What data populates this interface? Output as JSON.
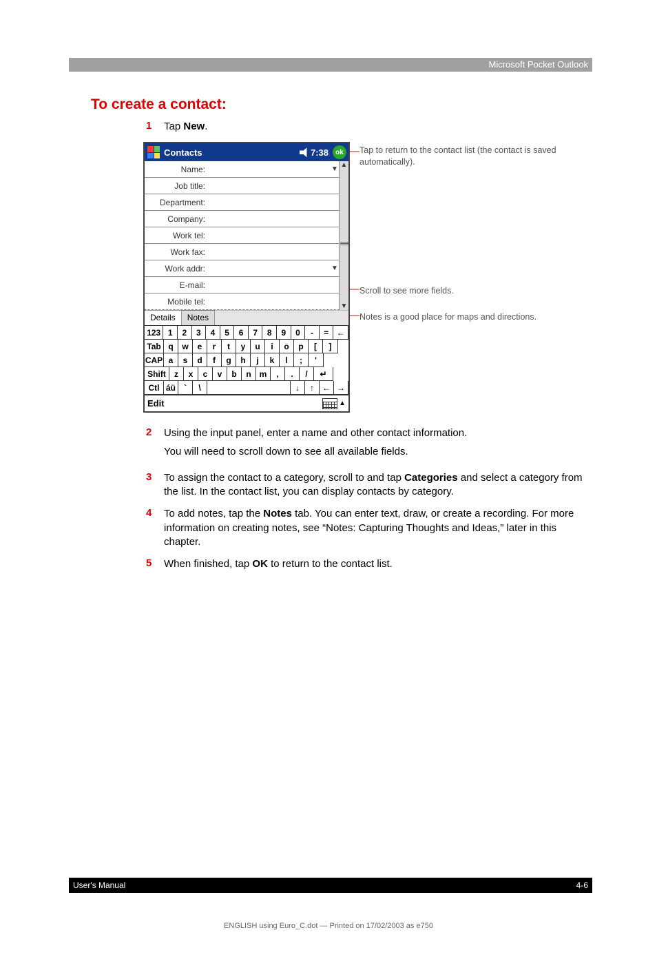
{
  "header": {
    "section": "Microsoft Pocket Outlook"
  },
  "title": "To create a contact:",
  "steps": {
    "s1": {
      "num": "1",
      "text_pre": "Tap ",
      "bold": "New",
      "text_post": "."
    },
    "s2": {
      "num": "2",
      "line1": "Using the input panel, enter a name and other contact information.",
      "line2": "You will need to scroll down to see all available fields."
    },
    "s3": {
      "num": "3",
      "pre": "To assign the contact to a category, scroll to and tap ",
      "bold": "Categories",
      "post": " and select a category from the list. In the contact list, you can display contacts by category."
    },
    "s4": {
      "num": "4",
      "pre": "To add notes, tap the ",
      "bold": "Notes",
      "post": " tab. You can enter text, draw, or create a recording. For more information on creating notes, see “Notes: Capturing Thoughts and Ideas,” later in this chapter."
    },
    "s5": {
      "num": "5",
      "pre": "When finished, tap ",
      "bold": "OK",
      "post": " to return to the contact list."
    }
  },
  "device": {
    "title": "Contacts",
    "time": "7:38",
    "ok": "ok",
    "fields": {
      "name": "Name:",
      "jobtitle": "Job title:",
      "department": "Department:",
      "company": "Company:",
      "worktel": "Work tel:",
      "workfax": "Work fax:",
      "workaddr": "Work addr:",
      "email": "E-mail:",
      "mobiletel": "Mobile tel:"
    },
    "tabs": {
      "details": "Details",
      "notes": "Notes"
    },
    "keyboard": {
      "r1": [
        "123",
        "1",
        "2",
        "3",
        "4",
        "5",
        "6",
        "7",
        "8",
        "9",
        "0",
        "-",
        "=",
        "←"
      ],
      "r2": [
        "Tab",
        "q",
        "w",
        "e",
        "r",
        "t",
        "y",
        "u",
        "i",
        "o",
        "p",
        "[",
        "]"
      ],
      "r3": [
        "CAP",
        "a",
        "s",
        "d",
        "f",
        "g",
        "h",
        "j",
        "k",
        "l",
        ";",
        "'"
      ],
      "r4": [
        "Shift",
        "z",
        "x",
        "c",
        "v",
        "b",
        "n",
        "m",
        ",",
        ".",
        "/",
        "↵"
      ],
      "r5": [
        "Ctl",
        "áü",
        "`",
        "\\",
        "↓",
        "↑",
        "←",
        "→"
      ]
    },
    "edit": "Edit"
  },
  "callouts": {
    "c1": "Tap to return to the contact list (the contact is saved automatically).",
    "c2": "Scroll to see more fields.",
    "c3": "Notes is a good place for maps and directions."
  },
  "footer": {
    "left": "User's Manual",
    "right": "4-6"
  },
  "printline": "ENGLISH using Euro_C.dot — Printed on 17/02/2003 as e750"
}
